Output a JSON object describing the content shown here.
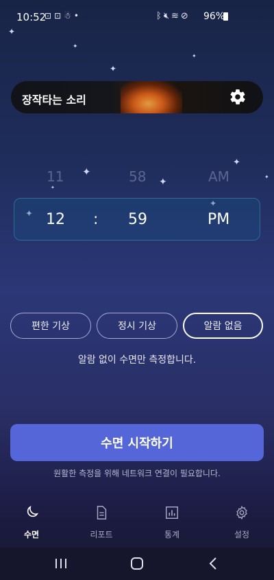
{
  "status_bar": {
    "time": "10:52",
    "left_icons": [
      "screenshot-icon",
      "screenshot-icon",
      "app-notification-icon",
      "dot-icon"
    ],
    "right_icons": [
      "bluetooth-icon",
      "mute-icon",
      "wifi-icon",
      "do-not-disturb-icon"
    ],
    "battery": "96%"
  },
  "sound_card": {
    "title": "장작타는 소리",
    "settings_icon": "gear-icon"
  },
  "time_picker": {
    "prev": {
      "hour": "11",
      "minute": "58",
      "period": "AM"
    },
    "selected": {
      "hour": "12",
      "separator": ":",
      "minute": "59",
      "period": "PM"
    }
  },
  "alarm_options": [
    {
      "label": "편한 기상",
      "selected": false
    },
    {
      "label": "정시 기상",
      "selected": false
    },
    {
      "label": "알람 없음",
      "selected": true
    }
  ],
  "alarm_description": "알람 없이 수면만 측정합니다.",
  "start_button": {
    "label": "수면 시작하기"
  },
  "network_note": "원활한 측정을 위해 네트워크 연결이 필요합니다.",
  "bottom_nav": [
    {
      "label": "수면",
      "icon": "moon-icon",
      "active": true
    },
    {
      "label": "리포트",
      "icon": "document-icon",
      "active": false
    },
    {
      "label": "통계",
      "icon": "bar-chart-icon",
      "active": false
    },
    {
      "label": "설정",
      "icon": "gear-icon",
      "active": false
    }
  ],
  "colors": {
    "accent": "#5567d8",
    "picker_border": "#2b6c9a"
  }
}
